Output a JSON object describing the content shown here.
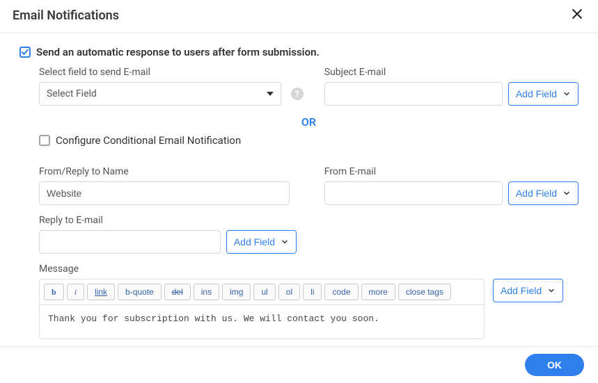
{
  "header": {
    "title": "Email Notifications"
  },
  "auto_response": {
    "checked": true,
    "label": "Send an automatic response to users after form submission."
  },
  "select_field": {
    "label": "Select field to send E-mail",
    "value": "Select Field"
  },
  "subject_email": {
    "label": "Subject E-mail",
    "value": ""
  },
  "or_text": "OR",
  "conditional": {
    "checked": false,
    "label": "Configure Conditional Email Notification"
  },
  "from_name": {
    "label": "From/Reply to Name",
    "value": "Website"
  },
  "from_email": {
    "label": "From E-mail",
    "value": ""
  },
  "reply_email": {
    "label": "Reply to E-mail",
    "value": ""
  },
  "message": {
    "label": "Message",
    "value": "Thank you for subscription with us. We will contact you soon."
  },
  "toolbar": {
    "b": "b",
    "i": "i",
    "link": "link",
    "bquote": "b-quote",
    "del": "del",
    "ins": "ins",
    "img": "img",
    "ul": "ul",
    "ol": "ol",
    "li": "li",
    "code": "code",
    "more": "more",
    "close_tags": "close tags"
  },
  "buttons": {
    "add_field": "Add Field",
    "ok": "OK"
  },
  "icons": {
    "help": "?"
  }
}
